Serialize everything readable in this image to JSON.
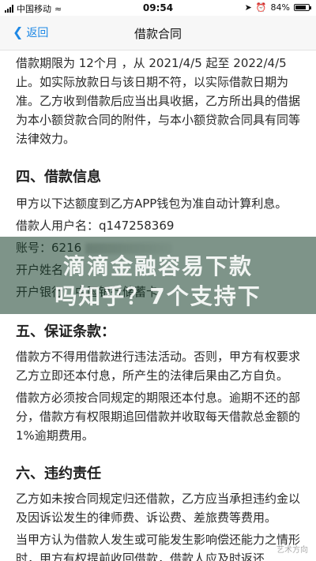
{
  "status_bar": {
    "carrier": "中国移动",
    "time": "09:54",
    "battery_percent": "84%",
    "battery_level": 0.84
  },
  "nav": {
    "back_label": "返回",
    "title": "借款合同"
  },
  "content": {
    "intro_paragraph": "借款期限为 12个月 ，从 2021/4/5 起至 2022/4/5 止。如实际放款日与该日期不符，以实际借款日期为准。乙方收到借款后应当出具收据，乙方所出具的借据为本小额贷款合同的附件，与本小额贷款合同具有同等法律效力。",
    "section4": {
      "heading": "四、借款信息",
      "line1": "甲方以下达额度到乙方APP钱包为准自动计算利息。",
      "username_label": "借款人用户名：",
      "username_value": "q147258369",
      "account_label": "账号：",
      "account_value": "6216",
      "account_holder_label": "开户姓名",
      "bank_label": "开户银行：",
      "bank_value": "中国银行储蓄卡"
    },
    "section5": {
      "heading": "五、保证条款：",
      "para1": "借款方不得用借款进行违法活动。否则，甲方有权要求乙方立即还本付息，所产生的法律后果由乙方自负。",
      "para2": "借款方必须按合同规定的期限还本付息。逾期不还的部分，借款方有权限期追回借款并收取每天借款总金额的1%逾期费用。"
    },
    "section6": {
      "heading": "六、违约责任",
      "para1": "乙方如未按合同规定归还借款，乙方应当承担违约金以及因诉讼发生的律师费、诉讼费、差旅费等费用。",
      "para2": "当甲方认为借款人发生或可能发生影响偿还能力之情形时，甲方有权提前收回借款，借款人应及时返还"
    }
  },
  "overlay": {
    "line1": "滴滴金融容易下款",
    "line2": "吗知乎？7个支持下"
  },
  "watermark": "艺术方向"
}
